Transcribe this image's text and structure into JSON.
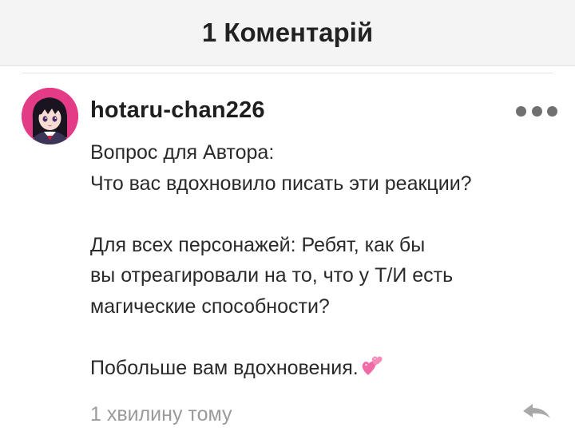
{
  "header": {
    "title": "1 Коментарій"
  },
  "comment": {
    "username": "hotaru-chan226",
    "lines": [
      "Вопрос для Автора:",
      "Что вас вдохновило писать эти реакции?",
      "",
      "Для всех персонажей: Ребят, как бы",
      "вы отреагировали на то, что у Т/И есть",
      "магические способности?",
      "",
      "Побольше вам вдохновения."
    ],
    "emoji": "two-hearts-icon",
    "timestamp": "1 хвилину тому"
  },
  "icons": {
    "more": "more-options-icon",
    "reply": "reply-icon"
  },
  "colors": {
    "header_bg": "#f4f4f4",
    "text": "#2a2a2a",
    "muted": "#9a9a9a",
    "avatar_bg": "#e33b86",
    "emoji_pink": "#f06aa6"
  }
}
